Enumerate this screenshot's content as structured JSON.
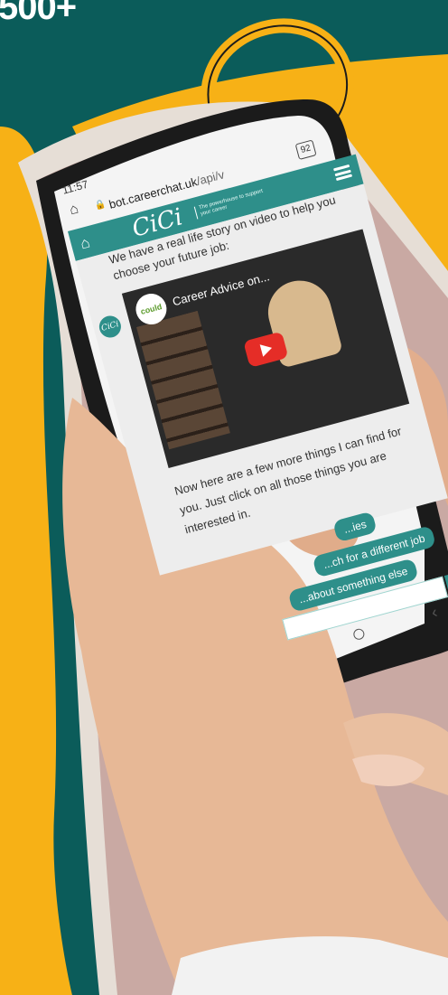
{
  "headline": "500+",
  "icons": [
    "home-icon",
    "lock-icon",
    "menu-icon",
    "play-icon",
    "send-icon"
  ],
  "colors": {
    "background_teal": "#0b5c5a",
    "accent_yellow": "#f7b116",
    "app_teal": "#2e8f8a",
    "youtube_red": "#e52d27"
  },
  "phone": {
    "status_time": "11:57",
    "url_host": "bot.careerchat.uk",
    "url_path": "/api/v",
    "tab_count": "92",
    "brand": "CiCi",
    "tagline": "The powerhouse to support your career",
    "avatar_label": "CiCi",
    "message_1": "We have a real life story on video to help you choose your future job:",
    "video_channel": "could",
    "video_title": "Career Advice on...",
    "message_2": "Now here are a few more things I can find for you. Just click on all those things you are interested in.",
    "chips": [
      "...ies",
      "...ch for a different job",
      "...about something else"
    ]
  }
}
